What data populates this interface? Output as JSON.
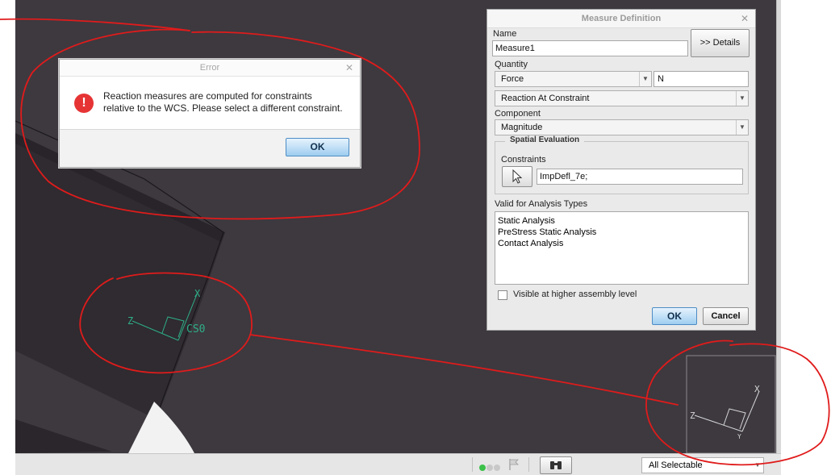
{
  "error_dialog": {
    "title": "Error",
    "close_glyph": "✕",
    "icon_glyph": "!",
    "message_line1": "Reaction measures are computed for constraints",
    "message_line2": "relative to the WCS.  Please select a different constraint.",
    "ok_label": "OK"
  },
  "measure_dialog": {
    "title": "Measure Definition",
    "close_glyph": "✕",
    "name_label": "Name",
    "name_value": "Measure1",
    "details_label": ">> Details",
    "quantity_label": "Quantity",
    "quantity_value": "Force",
    "unit_value": "N",
    "reaction_value": "Reaction At Constraint",
    "component_label": "Component",
    "component_value": "Magnitude",
    "spatial_legend": "Spatial Evaluation",
    "constraints_label": "Constraints",
    "constraints_value": "ImpDefl_7e;",
    "valid_label": "Valid for Analysis Types",
    "analysis_types": [
      "Static Analysis",
      "PreStress Static Analysis",
      "Contact Analysis"
    ],
    "visible_label": "Visible at higher assembly level",
    "visible_checked": false,
    "ok_label": "OK",
    "cancel_label": "Cancel"
  },
  "viewport": {
    "csys_name": "CS0",
    "axis_x": "X",
    "axis_z": "Z",
    "axis_y": "Y"
  },
  "statusbar": {
    "filter_value": "All Selectable"
  },
  "icons": {
    "status_dots": "status-dots-icon",
    "flag": "flag-icon",
    "binoculars": "binoculars-icon",
    "pointer": "cursor-arrow-icon",
    "error": "error-icon"
  },
  "colors": {
    "viewport_bg": "#3d393f",
    "annotation_red": "#e01b1b",
    "csys_green": "#2fae86",
    "error_red": "#e63434",
    "ok_blue": "#9fcdf0"
  }
}
